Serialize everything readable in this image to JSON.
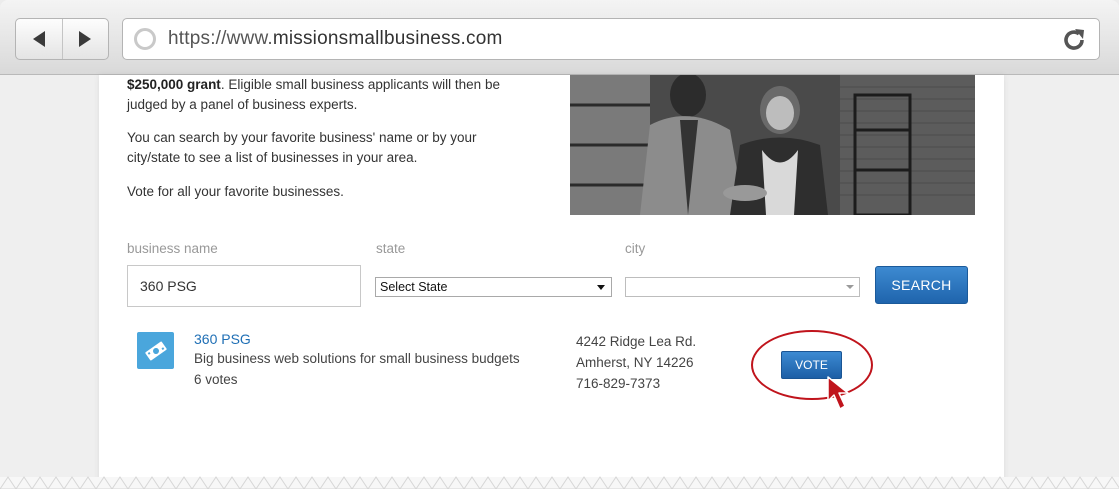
{
  "browser": {
    "url_prefix": "https://www.",
    "url_host": "missionsmallbusiness.com"
  },
  "intro": {
    "line1_bold": "$250,000 grant",
    "line1_rest": ". Eligible small business applicants will then be judged by a panel of business experts.",
    "line2": "You can search by your favorite business' name or by your city/state to see a list of businesses in your area.",
    "line3": "Vote for all your favorite businesses."
  },
  "search": {
    "business_name_label": "business name",
    "business_name_value": "360 PSG",
    "state_label": "state",
    "state_value": "Select State",
    "city_label": "city",
    "city_value": "",
    "search_button": "SEARCH"
  },
  "result": {
    "name": "360 PSG",
    "description": "Big business web solutions for small business budgets",
    "votes": "6 votes",
    "address_line1": "4242 Ridge Lea Rd.",
    "address_line2": "Amherst, NY 14226",
    "phone": "716-829-7373",
    "vote_button": "VOTE"
  },
  "colors": {
    "accent_blue": "#1f64ad",
    "link_blue": "#1f6fb5",
    "highlight_red": "#c0141c",
    "icon_blue": "#4aa6dc"
  }
}
